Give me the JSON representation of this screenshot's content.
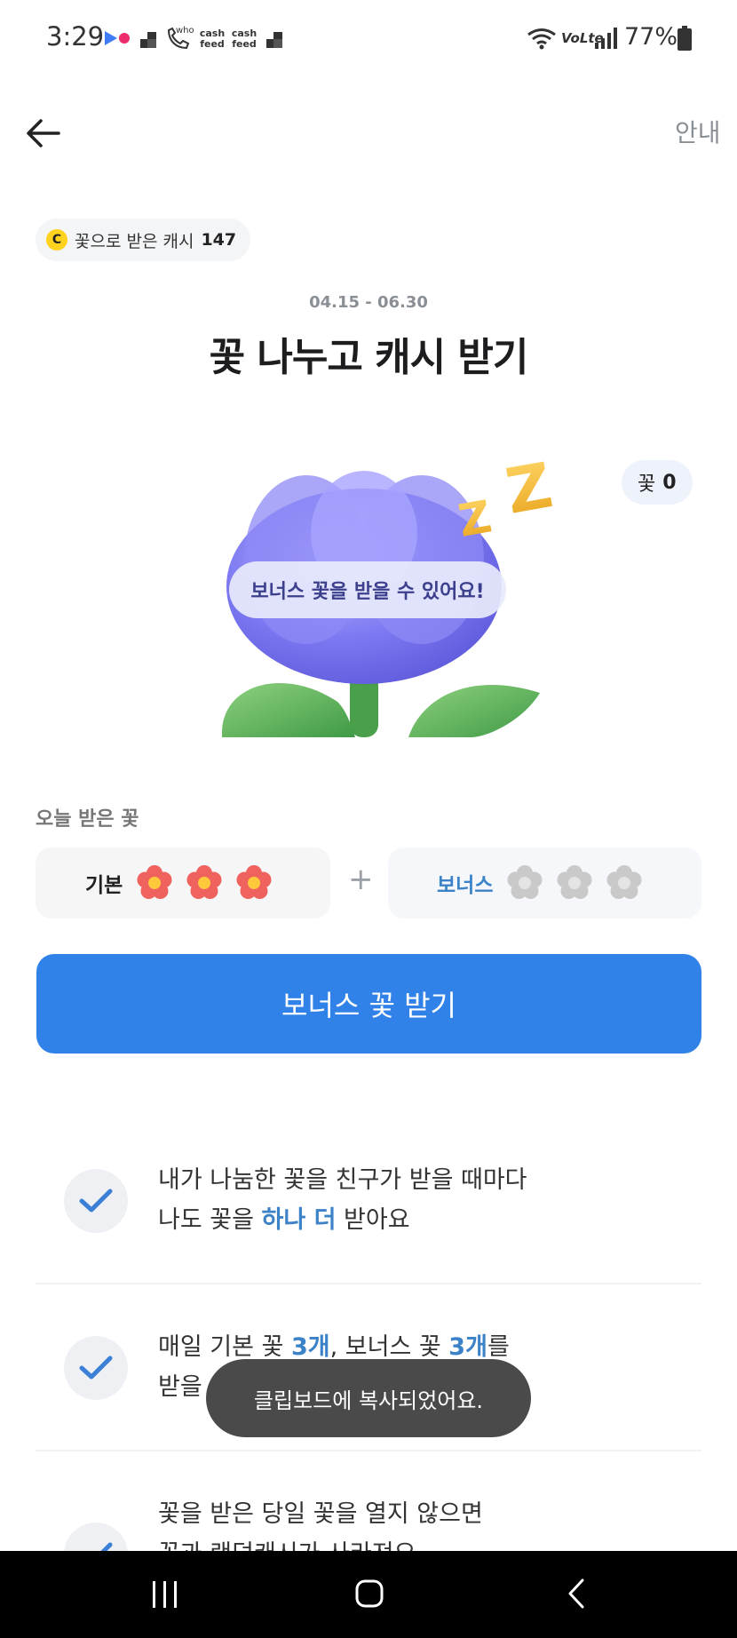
{
  "status_bar": {
    "time": "3:29",
    "battery": "77%",
    "notification_icons": [
      "flickr-icon",
      "app-icon",
      "phone-icon",
      "cashfeed-icon",
      "cashfeed-icon",
      "app-icon"
    ],
    "system_icons": [
      "wifi-icon",
      "volte-icon",
      "signal-icon",
      "battery-icon"
    ],
    "notif_labels": {
      "who": "who",
      "cash1": "cash",
      "feed1": "feed",
      "cash2": "cash",
      "feed2": "feed"
    },
    "volte": "VoLte"
  },
  "header": {
    "back_icon": "arrow-left-icon",
    "info_label": "안내"
  },
  "cash_chip": {
    "coin_symbol": "C",
    "label": "꽃으로 받은 캐시",
    "value": "147"
  },
  "event": {
    "period": "04.15 - 06.30",
    "title": "꽃 나누고 캐시 받기"
  },
  "illustration": {
    "flower_count_label": "꽃",
    "flower_count_value": "0",
    "bubble": "보너스 꽃을 받을 수 있어요!",
    "zzz": "ZZ"
  },
  "today": {
    "label": "오늘 받은 꽃",
    "basic_label": "기본",
    "bonus_label": "보너스",
    "plus": "+",
    "basic_count": 3,
    "bonus_count": 3
  },
  "cta": {
    "label": "보너스 꽃 받기"
  },
  "info_list": {
    "item1_line1": "내가 나눔한 꽃을 친구가 받을 때마다",
    "item1_pre": "나도 꽃을 ",
    "item1_hl": "하나 더",
    "item1_post": " 받아요",
    "item2_pre": "매일 기본 꽃 ",
    "item2_hl1": "3개",
    "item2_mid": ", 보너스 꽃 ",
    "item2_hl2": "3개",
    "item2_post": "를",
    "item2_line2": "받을 수 있어요",
    "item3_line1": "꽃을 받은 당일 꽃을 열지 않으면",
    "item3_line2": "꽃과 랜덤캐시가 사라져요"
  },
  "toast": {
    "message": "클립보드에 복사되었어요."
  },
  "colors": {
    "primary": "#3182e8",
    "highlight": "#3b82c8",
    "flower_red": "#f0625e",
    "flower_center": "#ffc93c",
    "flower_grey": "#c9c9c9"
  }
}
